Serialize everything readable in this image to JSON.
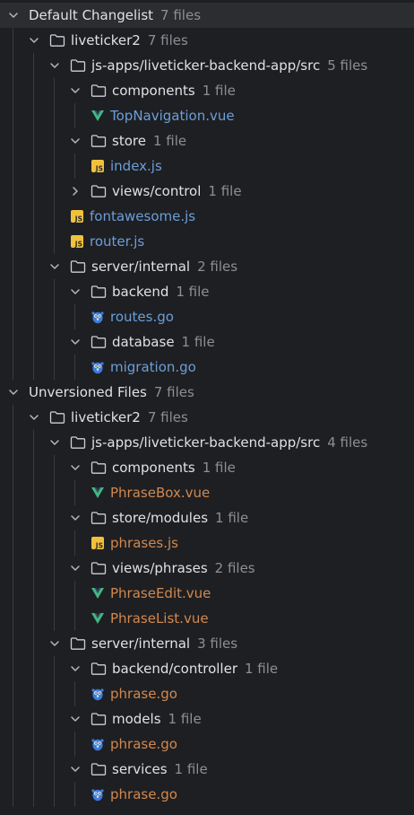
{
  "groups": [
    {
      "name": "Default Changelist",
      "count": "7 files",
      "nodes": [
        {
          "label": "liveticker2",
          "count": "7 files",
          "type": "folder",
          "depth": 1,
          "expanded": true
        },
        {
          "label": "js-apps/liveticker-backend-app/src",
          "count": "5 files",
          "type": "folder",
          "depth": 2,
          "expanded": true
        },
        {
          "label": "components",
          "count": "1 file",
          "type": "folder",
          "depth": 3,
          "expanded": true
        },
        {
          "label": "TopNavigation.vue",
          "type": "vue",
          "depth": 4
        },
        {
          "label": "store",
          "count": "1 file",
          "type": "folder",
          "depth": 3,
          "expanded": true
        },
        {
          "label": "index.js",
          "type": "js",
          "depth": 4
        },
        {
          "label": "views/control",
          "count": "1 file",
          "type": "folder",
          "depth": 3,
          "expanded": false
        },
        {
          "label": "fontawesome.js",
          "type": "js",
          "depth": 3
        },
        {
          "label": "router.js",
          "type": "js",
          "depth": 3
        },
        {
          "label": "server/internal",
          "count": "2 files",
          "type": "folder",
          "depth": 2,
          "expanded": true
        },
        {
          "label": "backend",
          "count": "1 file",
          "type": "folder",
          "depth": 3,
          "expanded": true
        },
        {
          "label": "routes.go",
          "type": "go",
          "depth": 4
        },
        {
          "label": "database",
          "count": "1 file",
          "type": "folder",
          "depth": 3,
          "expanded": true
        },
        {
          "label": "migration.go",
          "type": "go",
          "depth": 4
        }
      ]
    },
    {
      "name": "Unversioned Files",
      "count": "7 files",
      "nodes": [
        {
          "label": "liveticker2",
          "count": "7 files",
          "type": "folder",
          "depth": 1,
          "expanded": true
        },
        {
          "label": "js-apps/liveticker-backend-app/src",
          "count": "4 files",
          "type": "folder",
          "depth": 2,
          "expanded": true
        },
        {
          "label": "components",
          "count": "1 file",
          "type": "folder",
          "depth": 3,
          "expanded": true
        },
        {
          "label": "PhraseBox.vue",
          "type": "vue",
          "depth": 4
        },
        {
          "label": "store/modules",
          "count": "1 file",
          "type": "folder",
          "depth": 3,
          "expanded": true
        },
        {
          "label": "phrases.js",
          "type": "js",
          "depth": 4
        },
        {
          "label": "views/phrases",
          "count": "2 files",
          "type": "folder",
          "depth": 3,
          "expanded": true
        },
        {
          "label": "PhraseEdit.vue",
          "type": "vue",
          "depth": 4
        },
        {
          "label": "PhraseList.vue",
          "type": "vue",
          "depth": 4
        },
        {
          "label": "server/internal",
          "count": "3 files",
          "type": "folder",
          "depth": 2,
          "expanded": true
        },
        {
          "label": "backend/controller",
          "count": "1 file",
          "type": "folder",
          "depth": 3,
          "expanded": true
        },
        {
          "label": "phrase.go",
          "type": "go",
          "depth": 4
        },
        {
          "label": "models",
          "count": "1 file",
          "type": "folder",
          "depth": 3,
          "expanded": true
        },
        {
          "label": "phrase.go",
          "type": "go",
          "depth": 4
        },
        {
          "label": "services",
          "count": "1 file",
          "type": "folder",
          "depth": 3,
          "expanded": true
        },
        {
          "label": "phrase.go",
          "type": "go",
          "depth": 4
        }
      ]
    }
  ],
  "colors": {
    "background": "#1e1f22",
    "selected_row": "#2b2d30",
    "modified_file": "#6c9ed9",
    "unversioned_file": "#d2884f",
    "count_text": "#8c8f94",
    "vue_green": "#41b883",
    "js_yellow": "#f0c13c",
    "go_blue": "#3b7ddd"
  }
}
